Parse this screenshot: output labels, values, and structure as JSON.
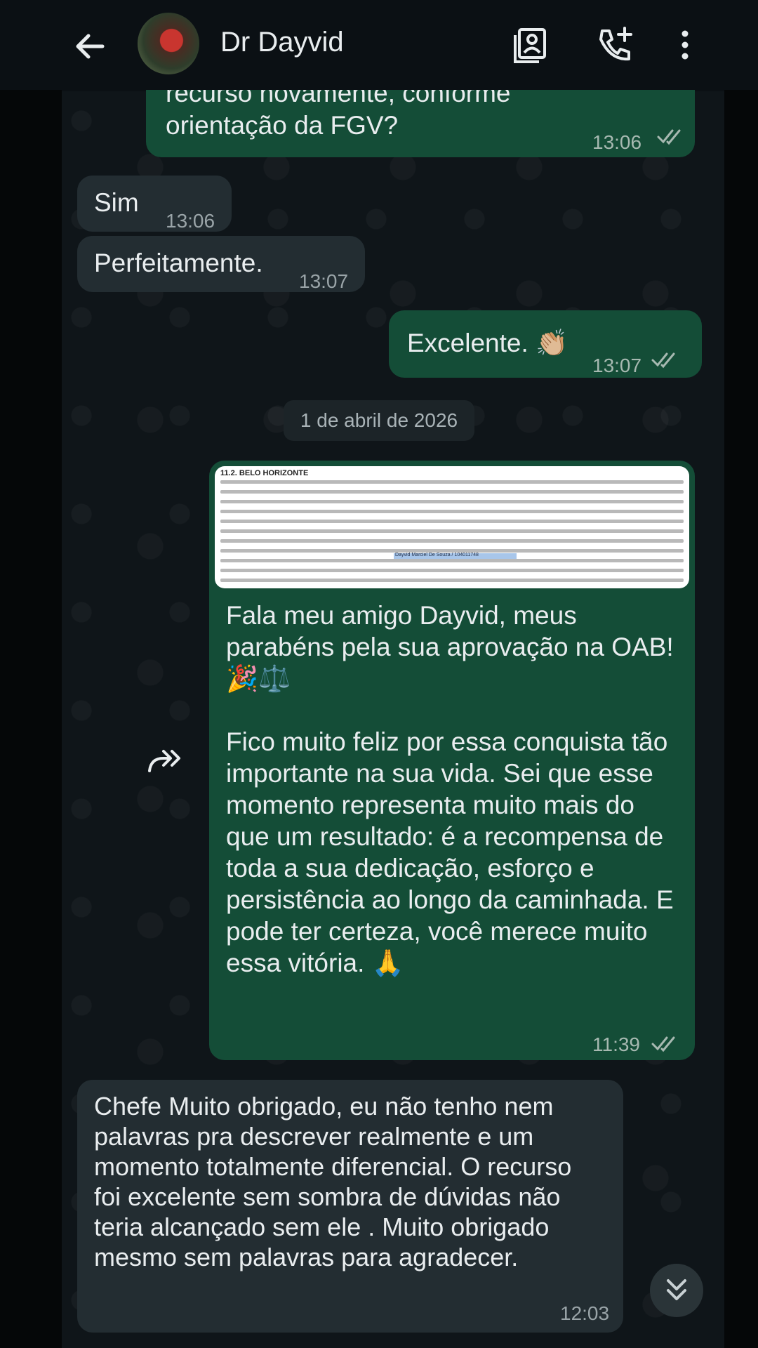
{
  "header": {
    "contact_name": "Dr Dayvid",
    "back_icon": "arrow-left-icon",
    "video_icon": "contact-card-icon",
    "call_icon": "add-call-icon",
    "menu_icon": "more-vert-icon"
  },
  "messages": [
    {
      "dir": "out",
      "text": "recurso novamente, conforme orientação da FGV?",
      "time": "13:06"
    },
    {
      "dir": "in",
      "text": "Sim",
      "time": "13:06"
    },
    {
      "dir": "in",
      "text": "Perfeitamente.",
      "time": "13:07"
    },
    {
      "dir": "out",
      "text": "Excelente. 👏🏼",
      "time": "13:07"
    },
    {
      "dir": "out",
      "text": "Fala meu amigo Dayvid, meus parabéns pela sua aprovação na OAB! 🎉⚖️\n\nFico muito feliz por essa conquista tão importante na sua vida. Sei que esse momento representa muito mais do que um resultado: é a recompensa de toda a sua dedicação, esforço e persistência ao longo da caminhada. E pode ter certeza, você merece muito essa vitória. 🙏",
      "time": "11:39"
    },
    {
      "dir": "in",
      "text": "Chefe Muito obrigado, eu não tenho nem palavras pra descrever realmente e um momento totalmente diferencial.  O recurso foi excelente sem sombra de dúvidas não teria alcançado sem ele . Muito obrigado mesmo sem palavras para agradecer.",
      "time": "12:03"
    }
  ],
  "date_chip": "1 de abril de 2026",
  "doc": {
    "title": "11.2. BELO HORIZONTE",
    "highlight": "Dayvid Marciel De Souza / 104011748"
  },
  "colors": {
    "outgoing_bubble": "#144d37",
    "incoming_bubble": "#232d32",
    "background": "#0b1014",
    "read_ticks": "#a7b9b1"
  }
}
